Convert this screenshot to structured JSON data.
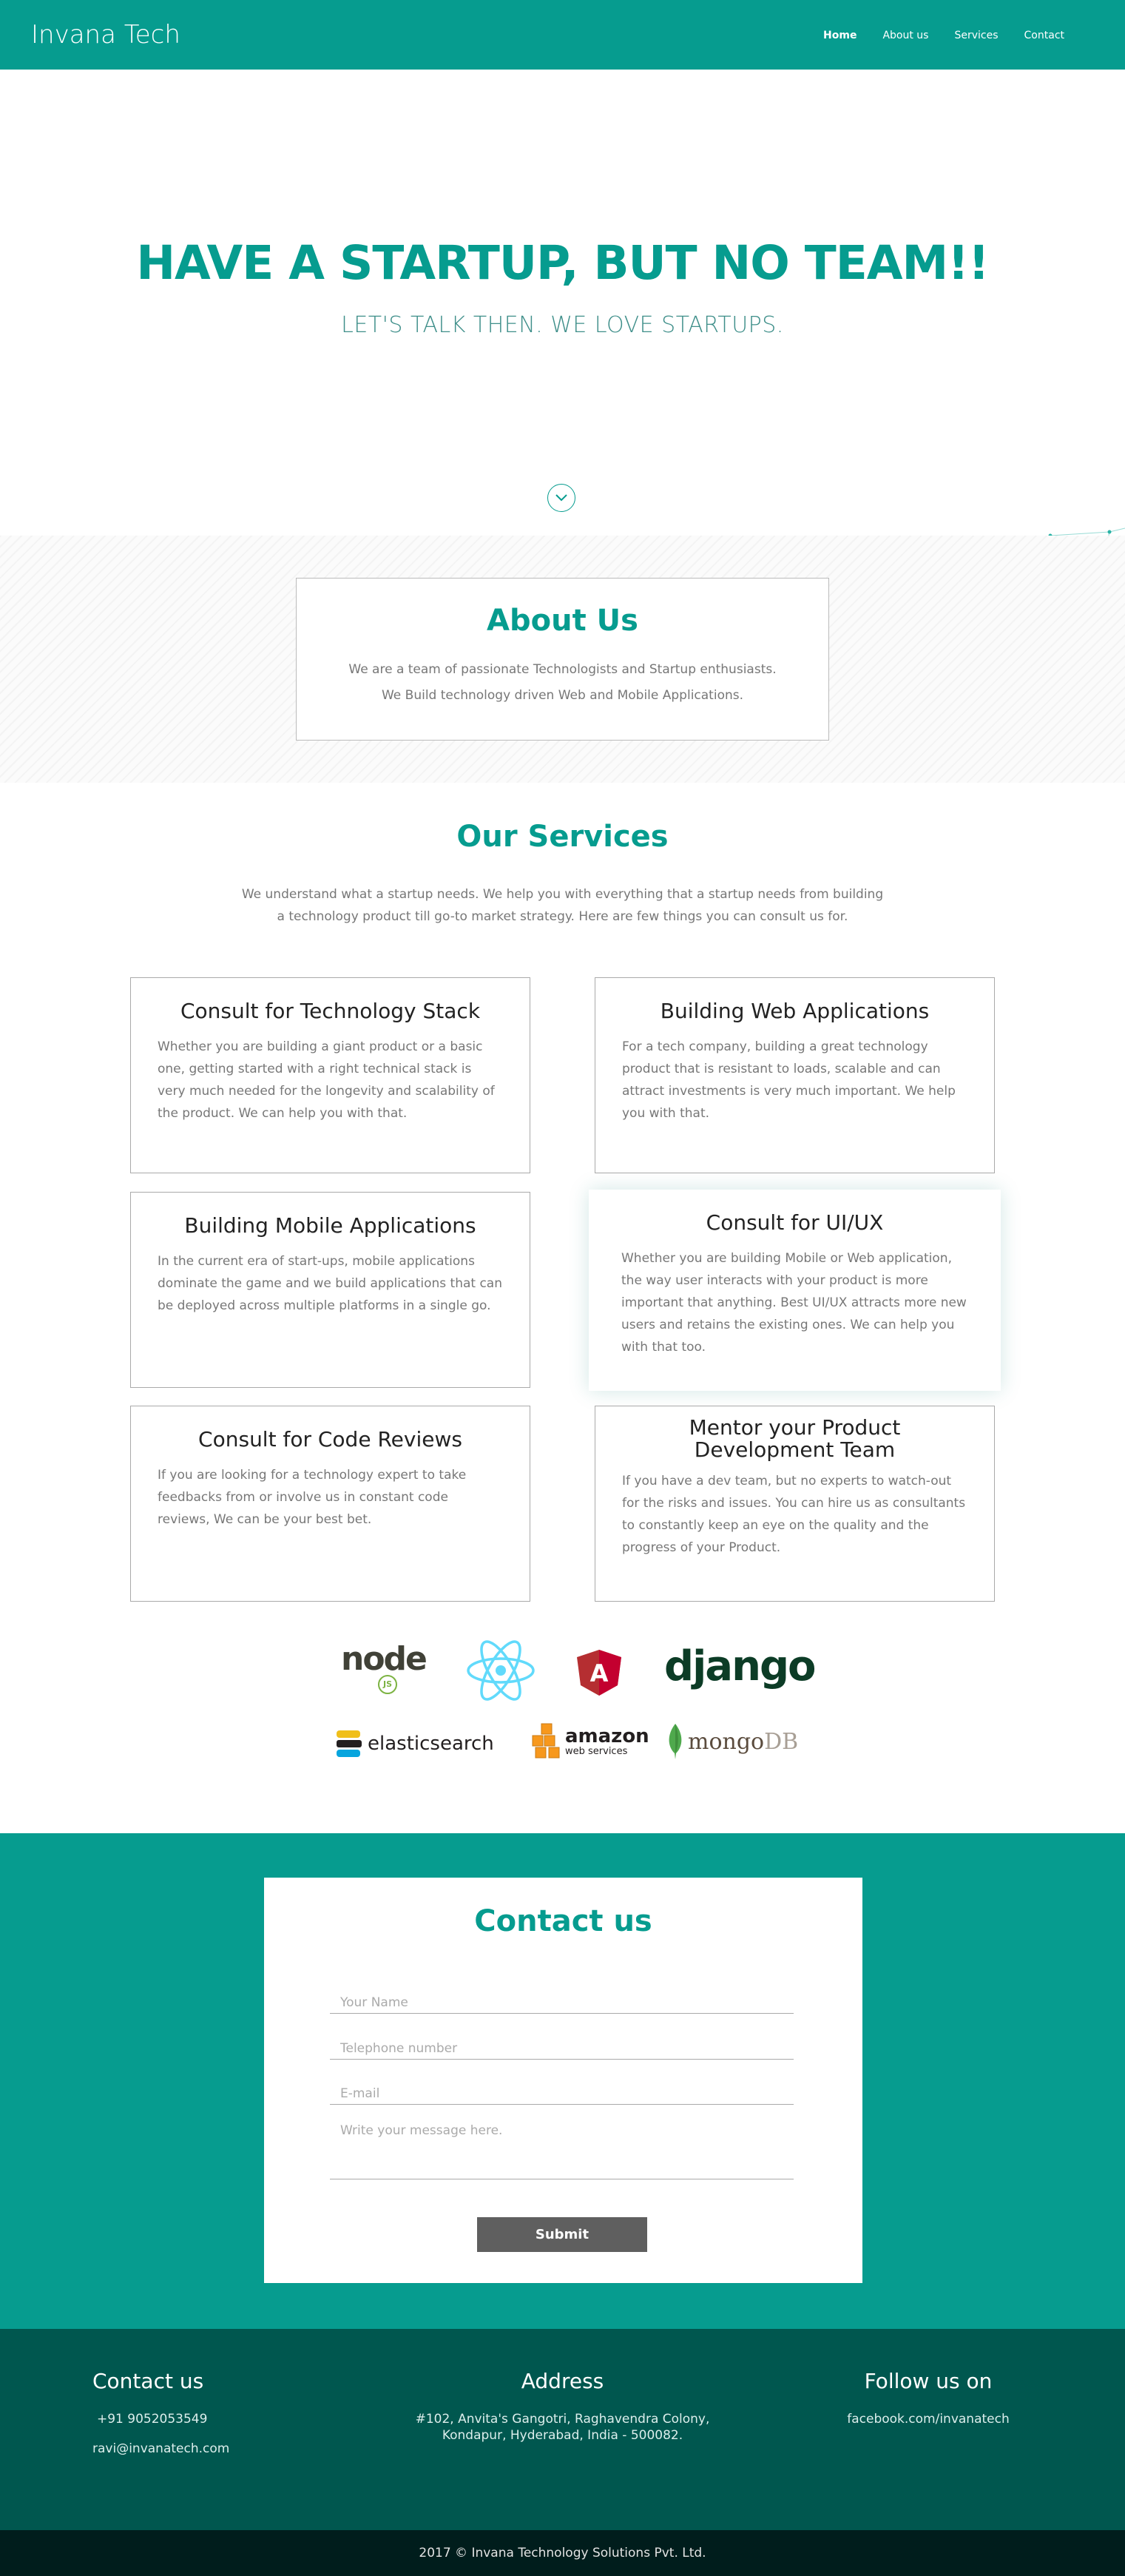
{
  "nav": {
    "brand": "Invana Tech",
    "items": [
      {
        "label": "Home",
        "active": true
      },
      {
        "label": "About us",
        "active": false
      },
      {
        "label": "Services",
        "active": false
      },
      {
        "label": "Contact",
        "active": false
      }
    ]
  },
  "hero": {
    "title": "HAVE A STARTUP, BUT NO TEAM!!",
    "subtitle": "LET'S TALK THEN. WE LOVE STARTUPS.",
    "scroll_icon": "chevron-down-icon"
  },
  "about": {
    "title": "About Us",
    "line1": "We are a team of passionate Technologists and Startup enthusiasts.",
    "line2": "We Build technology driven Web and Mobile Applications."
  },
  "services": {
    "title": "Our Services",
    "intro_line1": "We understand what a startup needs. We help you with everything that a startup needs from building",
    "intro_line2": "a technology product till go-to market strategy. Here are few things you can consult us for.",
    "cards": [
      {
        "title": "Consult for Technology Stack",
        "text": "Whether you are building a giant product or a basic one, getting started with a right technical stack is very much needed for the longevity and scalability of the product. We can help you with that."
      },
      {
        "title": "Building Web Applications",
        "text": "For a tech company, building a great technology product that is resistant to loads, scalable and can attract investments is very much important. We help you with that."
      },
      {
        "title": "Building Mobile Applications",
        "text": "In the current era of start-ups, mobile applications dominate the game and we build applications that can be deployed across multiple platforms in a single go."
      },
      {
        "title": "Consult for UI/UX",
        "text": "Whether you are building Mobile or Web application, the way user interacts with your product is more important that anything. Best UI/UX attracts more new users and retains the existing ones. We can help you with that too."
      },
      {
        "title": "Consult for Code Reviews",
        "text": "If you are looking for a technology expert to take feedbacks from or involve us in constant code reviews, We can be your best bet."
      },
      {
        "title": "Mentor your Product Development Team",
        "text": "If you have a dev team, but no experts to watch-out for the risks and issues. You can hire us as consultants to constantly keep an eye on the quality and the progress of your Product."
      }
    ]
  },
  "tech_logos": {
    "node": "node",
    "node_js": "JS",
    "react": "react-logo-icon",
    "angular": "A",
    "django": "django",
    "elasticsearch": "elasticsearch",
    "aws_main": "amazon",
    "aws_sub": "web services",
    "mongo_a": "mongo",
    "mongo_b": "DB"
  },
  "contact": {
    "title": "Contact us",
    "name_placeholder": "Your Name",
    "phone_placeholder": "Telephone number",
    "email_placeholder": "E-mail",
    "message_placeholder": "Write your message here.",
    "submit_label": "Submit"
  },
  "footer": {
    "contact_title": "Contact us",
    "phone": "+91 9052053549",
    "email": "ravi@invanatech.com",
    "address_title": "Address",
    "address_line1": "#102, Anvita's Gangotri, Raghavendra Colony,",
    "address_line2": "Kondapur, Hyderabad, India - 500082.",
    "follow_title": "Follow us on",
    "facebook": "facebook.com/invanatech",
    "copyright": "2017 © Invana Technology Solutions Pvt. Ltd."
  },
  "colors": {
    "brand": "#069c8f",
    "footer": "#00574f",
    "copyright_bar": "#001d1c",
    "submit": "#5f5f5f"
  }
}
